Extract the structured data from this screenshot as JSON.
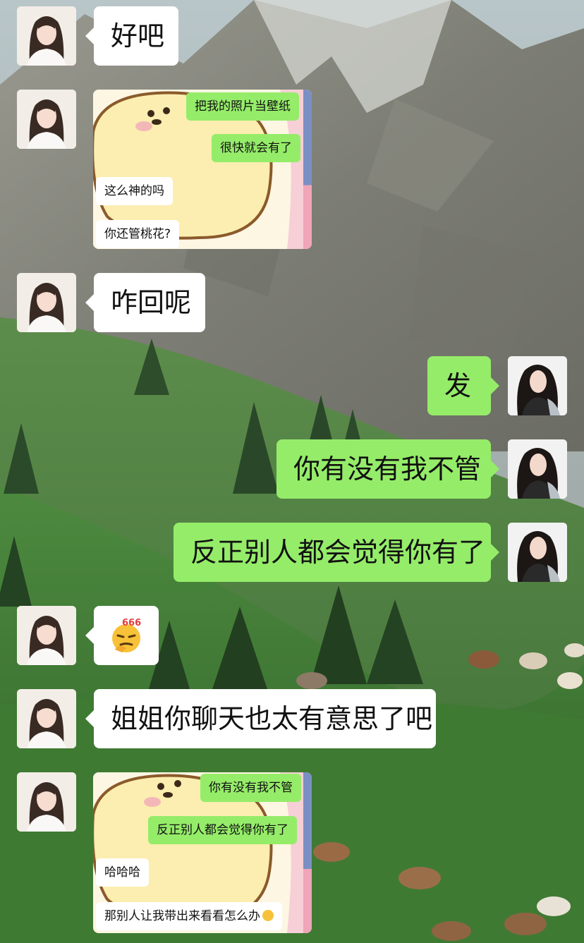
{
  "messages": {
    "m1": {
      "sender": "contact",
      "text": "好吧"
    },
    "m2": {
      "sender": "contact",
      "type": "image",
      "lines": [
        "把我的照片当壁纸",
        "很快就会有了",
        "这么神的吗",
        "你还管桃花?"
      ]
    },
    "m3": {
      "sender": "contact",
      "text": "咋回呢"
    },
    "m4": {
      "sender": "me",
      "text": "发"
    },
    "m5": {
      "sender": "me",
      "text": "你有没有我不管"
    },
    "m6": {
      "sender": "me",
      "text": "反正别人都会觉得你有了"
    },
    "m7": {
      "sender": "contact",
      "type": "sticker",
      "emoji": "thinking-666-emoji",
      "badge": "666"
    },
    "m8": {
      "sender": "contact",
      "text": "姐姐你聊天也太有意思了吧"
    },
    "m9": {
      "sender": "contact",
      "type": "image",
      "lines": [
        "你有没有我不管",
        "反正别人都会觉得你有了",
        "哈哈哈",
        "那别人让我带出来看看怎么办"
      ]
    }
  },
  "colors": {
    "bubble_out": "#95ec69",
    "bubble_in": "#ffffff"
  },
  "icons": {
    "contact_avatar": "woman-portrait-avatar",
    "my_avatar": "woman-portrait-avatar",
    "sticker": "thinking-face-emoji"
  }
}
